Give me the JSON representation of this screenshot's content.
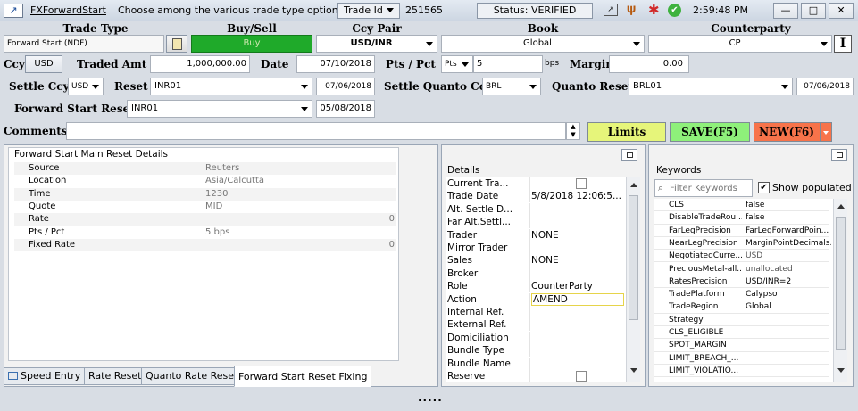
{
  "titlebar": {
    "app_title": "FXForwardStart",
    "message": "Choose among the various trade type options",
    "trade_id_label": "Trade Id",
    "trade_id_value": "251565",
    "status": "Status: VERIFIED",
    "time": "2:59:48 PM"
  },
  "header": {
    "trade_type_label": "Trade Type",
    "trade_type_value": "Forward Start (NDF)",
    "buy_sell_label": "Buy/Sell",
    "buy_sell_value": "Buy",
    "ccy_pair_label": "Ccy Pair",
    "ccy_pair_value": "USD/INR",
    "book_label": "Book",
    "book_value": "Global",
    "counterparty_label": "Counterparty",
    "counterparty_value": "CP"
  },
  "row1": {
    "ccy_label": "Ccy",
    "ccy_value": "USD",
    "traded_amt_label": "Traded Amt",
    "traded_amt_value": "1,000,000.00",
    "date_label": "Date",
    "date_value": "07/10/2018",
    "pts_pct_label": "Pts / Pct",
    "pts_select": "Pts",
    "pts_value": "5",
    "bps_label": "bps",
    "margin_label": "Margin",
    "margin_value": "0.00"
  },
  "row2": {
    "settle_ccy_label": "Settle Ccy",
    "settle_ccy_value": "USD",
    "reset_label": "Reset",
    "reset_value": "INR01",
    "reset_date": "07/06/2018",
    "settle_quanto_label": "Settle Quanto Ccy",
    "settle_quanto_value": "BRL",
    "quanto_reset_label": "Quanto Reset",
    "quanto_reset_value": "BRL01",
    "quanto_reset_date": "07/06/2018"
  },
  "row3": {
    "fsr_label": "Forward Start Reset",
    "fsr_value": "INR01",
    "fsr_date": "05/08/2018"
  },
  "comments": {
    "label": "Comments",
    "value": ""
  },
  "actions": {
    "limits": "Limits",
    "save": "SAVE(F5)",
    "new": "NEW(F6)"
  },
  "reset_details": {
    "title": "Forward Start Main Reset Details",
    "rows": [
      {
        "label": "Source",
        "value": "Reuters",
        "num": ""
      },
      {
        "label": "Location",
        "value": "Asia/Calcutta",
        "num": ""
      },
      {
        "label": "Time",
        "value": "1230",
        "num": ""
      },
      {
        "label": "Quote",
        "value": "MID",
        "num": ""
      },
      {
        "label": "Rate",
        "value": "",
        "num": "0"
      },
      {
        "label": "Pts / Pct",
        "value": "5 bps",
        "num": ""
      },
      {
        "label": "Fixed Rate",
        "value": "",
        "num": "0"
      }
    ]
  },
  "tabs": [
    "Speed Entry",
    "Rate Reset",
    "Quanto Rate Reset",
    "Forward Start Reset Fixing"
  ],
  "details": {
    "title": "Details",
    "rows": [
      {
        "label": "Current Tra...",
        "value": ""
      },
      {
        "label": "Trade Date",
        "value": "5/8/2018 12:06:5..."
      },
      {
        "label": "Alt. Settle D...",
        "value": ""
      },
      {
        "label": "Far Alt.Settl...",
        "value": ""
      },
      {
        "label": "Trader",
        "value": "NONE"
      },
      {
        "label": "Mirror Trader",
        "value": ""
      },
      {
        "label": "Sales",
        "value": "NONE"
      },
      {
        "label": "Broker",
        "value": ""
      },
      {
        "label": "Role",
        "value": "CounterParty"
      },
      {
        "label": "Action",
        "value": "AMEND"
      },
      {
        "label": "Internal Ref.",
        "value": ""
      },
      {
        "label": "External Ref.",
        "value": ""
      },
      {
        "label": "Domiciliation",
        "value": ""
      },
      {
        "label": "Bundle Type",
        "value": ""
      },
      {
        "label": "Bundle Name",
        "value": ""
      },
      {
        "label": "Reserve",
        "value": ""
      }
    ]
  },
  "keywords": {
    "title": "Keywords",
    "filter_placeholder": "Filter Keywords",
    "show_populated": "Show populated",
    "rows": [
      {
        "k": "CLS",
        "v": "false"
      },
      {
        "k": "DisableTradeRou...",
        "v": "false"
      },
      {
        "k": "FarLegPrecision",
        "v": "FarLegForwardPoin..."
      },
      {
        "k": "NearLegPrecision",
        "v": "MarginPointDecimals..."
      },
      {
        "k": "NegotiatedCurre...",
        "v": "USD"
      },
      {
        "k": "PreciousMetal-all...",
        "v": "unallocated"
      },
      {
        "k": "RatesPrecision",
        "v": "USD/INR=2"
      },
      {
        "k": "TradePlatform",
        "v": "Calypso"
      },
      {
        "k": "TradeRegion",
        "v": "Global"
      },
      {
        "k": "Strategy",
        "v": ""
      },
      {
        "k": "CLS_ELIGIBLE",
        "v": ""
      },
      {
        "k": "SPOT_MARGIN",
        "v": ""
      },
      {
        "k": "LIMIT_BREACH_...",
        "v": ""
      },
      {
        "k": "LIMIT_VIOLATIO...",
        "v": ""
      }
    ]
  },
  "footer": {
    "grip": "....."
  },
  "colors": {
    "buy_green": "#1faa2a",
    "limits_yellow": "#e6f57a",
    "save_green": "#8ef07a",
    "new_orange": "#f7734a"
  }
}
